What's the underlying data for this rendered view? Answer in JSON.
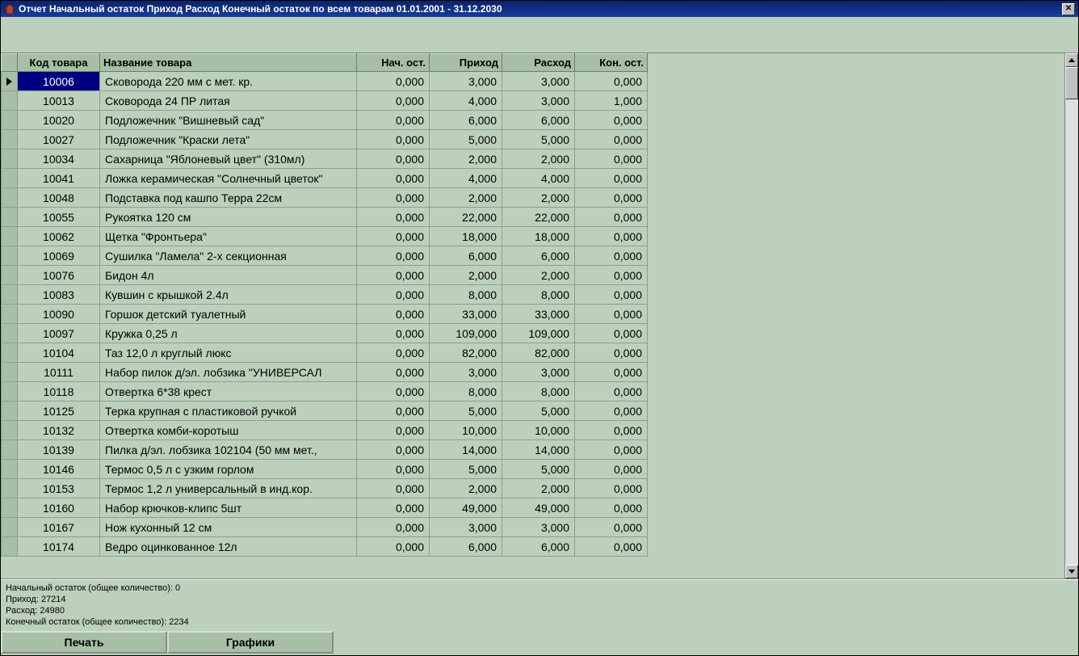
{
  "titlebar": {
    "title": "Отчет Начальный остаток Приход Расход Конечный остаток по всем товарам   01.01.2001 - 31.12.2030"
  },
  "headers": {
    "code": "Код товара",
    "name": "Название товара",
    "start": "Нач. ост.",
    "in": "Приход",
    "out": "Расход",
    "end": "Кон. ост."
  },
  "rows": [
    {
      "code": "10006",
      "name": "Сковорода 220 мм с мет. кр.",
      "start": "0,000",
      "in": "3,000",
      "out": "3,000",
      "end": "0,000",
      "selected": true
    },
    {
      "code": "10013",
      "name": "Сковорода 24 ПР литая",
      "start": "0,000",
      "in": "4,000",
      "out": "3,000",
      "end": "1,000"
    },
    {
      "code": "10020",
      "name": "Подложечник \"Вишневый сад\"",
      "start": "0,000",
      "in": "6,000",
      "out": "6,000",
      "end": "0,000"
    },
    {
      "code": "10027",
      "name": "Подложечник \"Краски лета\"",
      "start": "0,000",
      "in": "5,000",
      "out": "5,000",
      "end": "0,000"
    },
    {
      "code": "10034",
      "name": "Сахарница \"Яблоневый цвет\" (310мл)",
      "start": "0,000",
      "in": "2,000",
      "out": "2,000",
      "end": "0,000"
    },
    {
      "code": "10041",
      "name": "Ложка керамическая \"Солнечный цветок\"",
      "start": "0,000",
      "in": "4,000",
      "out": "4,000",
      "end": "0,000"
    },
    {
      "code": "10048",
      "name": "Подставка под кашпо Терра 22см",
      "start": "0,000",
      "in": "2,000",
      "out": "2,000",
      "end": "0,000"
    },
    {
      "code": "10055",
      "name": "Рукоятка 120 см",
      "start": "0,000",
      "in": "22,000",
      "out": "22,000",
      "end": "0,000"
    },
    {
      "code": "10062",
      "name": "Щетка \"Фронтьера\"",
      "start": "0,000",
      "in": "18,000",
      "out": "18,000",
      "end": "0,000"
    },
    {
      "code": "10069",
      "name": "Сушилка \"Ламела\" 2-х секционная",
      "start": "0,000",
      "in": "6,000",
      "out": "6,000",
      "end": "0,000"
    },
    {
      "code": "10076",
      "name": "Бидон 4л",
      "start": "0,000",
      "in": "2,000",
      "out": "2,000",
      "end": "0,000"
    },
    {
      "code": "10083",
      "name": "Кувшин с крышкой 2.4л",
      "start": "0,000",
      "in": "8,000",
      "out": "8,000",
      "end": "0,000"
    },
    {
      "code": "10090",
      "name": "Горшок детский туалетный",
      "start": "0,000",
      "in": "33,000",
      "out": "33,000",
      "end": "0,000"
    },
    {
      "code": "10097",
      "name": "Кружка 0,25 л",
      "start": "0,000",
      "in": "109,000",
      "out": "109,000",
      "end": "0,000"
    },
    {
      "code": "10104",
      "name": "Таз 12,0 л круглый люкс",
      "start": "0,000",
      "in": "82,000",
      "out": "82,000",
      "end": "0,000"
    },
    {
      "code": "10111",
      "name": "Набор пилок д/эл. лобзика \"УНИВЕРСАЛ",
      "start": "0,000",
      "in": "3,000",
      "out": "3,000",
      "end": "0,000"
    },
    {
      "code": "10118",
      "name": "Отвертка 6*38 крест",
      "start": "0,000",
      "in": "8,000",
      "out": "8,000",
      "end": "0,000"
    },
    {
      "code": "10125",
      "name": "Терка крупная с пластиковой ручкой",
      "start": "0,000",
      "in": "5,000",
      "out": "5,000",
      "end": "0,000"
    },
    {
      "code": "10132",
      "name": "Отвертка комби-коротыш",
      "start": "0,000",
      "in": "10,000",
      "out": "10,000",
      "end": "0,000"
    },
    {
      "code": "10139",
      "name": "Пилка д/эл. лобзика 102104 (50 мм мет.,",
      "start": "0,000",
      "in": "14,000",
      "out": "14,000",
      "end": "0,000"
    },
    {
      "code": "10146",
      "name": "Термос 0,5 л с узким горлом",
      "start": "0,000",
      "in": "5,000",
      "out": "5,000",
      "end": "0,000"
    },
    {
      "code": "10153",
      "name": "Термос 1,2 л универсальный в инд.кор.",
      "start": "0,000",
      "in": "2,000",
      "out": "2,000",
      "end": "0,000"
    },
    {
      "code": "10160",
      "name": "Набор крючков-клипс 5шт",
      "start": "0,000",
      "in": "49,000",
      "out": "49,000",
      "end": "0,000"
    },
    {
      "code": "10167",
      "name": "Нож кухонный 12 см",
      "start": "0,000",
      "in": "3,000",
      "out": "3,000",
      "end": "0,000"
    },
    {
      "code": "10174",
      "name": "Ведро оцинкованное 12л",
      "start": "0,000",
      "in": "6,000",
      "out": "6,000",
      "end": "0,000"
    }
  ],
  "summary": {
    "line1": "Начальный остаток (общее количество): 0",
    "line2": "Приход: 27214",
    "line3": "Расход: 24980",
    "line4": "Конечный остаток (общее количество): 2234"
  },
  "buttons": {
    "print": "Печать",
    "charts": "Графики"
  }
}
